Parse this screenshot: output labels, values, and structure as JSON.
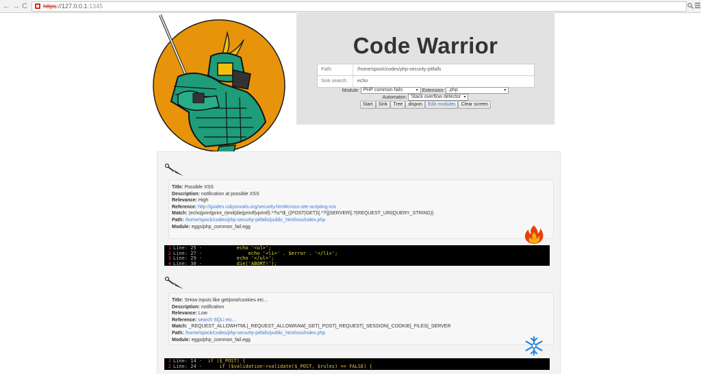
{
  "browser": {
    "back": "←",
    "forward": "→",
    "reload": "C",
    "url_scheme": "https",
    "url_host": "://127.0.0.1",
    "url_port": ":1345",
    "zoom_icon": "magnifier-icon",
    "menu_icon": "menu-icon"
  },
  "app": {
    "title": "Code Warrior"
  },
  "form": {
    "path_label": "Path:",
    "path_value": "/home/spock/codes/php-security-pitfalls",
    "sink_label": "Sink search:",
    "sink_value": "echo",
    "module_label": "Module:",
    "module_value": "PHP common fails",
    "extension_label": "Extension:",
    "extension_value": ".php",
    "automaton_label": "Automaton:",
    "automaton_value": "Stack overflow detector"
  },
  "buttons": {
    "start": "Start",
    "sink": "Sink",
    "tree": "Tree",
    "dispon": "dispon",
    "edit_modules": "Edit modules",
    "clear_screen": "Clear screen"
  },
  "results": [
    {
      "title_label": "Title:",
      "title": "Possible XSS",
      "description_label": "Description:",
      "description": "notification at possible XSS",
      "relevance_label": "Relevance:",
      "relevance": "High",
      "reference_label": "Reference:",
      "reference": "http://guides.rubyonrails.org/security.html#cross-site-scripting-xss",
      "match_label": "Match:",
      "match": "(echo|print|print_r|exit|die|printf|vprintf).*?\\s*\\$_((POST|GET)\\[.*?\\]|SERVER\\[.?(REQUEST_URI|QUERY_STRING))",
      "path_label": "Path:",
      "path": "/home/spock/codes/php-security-pitfalls/public_html/xss/index.php",
      "module_label": "Module:",
      "module": "eggs/php_common_fail.egg",
      "badge": "fire-icon",
      "code": [
        {
          "n": "1",
          "line": "Line: 25 -",
          "code": "            echo '<ul>';"
        },
        {
          "n": "2",
          "line": "Line: 27 -",
          "code": "                echo '<li>' . $error . '</li>';"
        },
        {
          "n": "3",
          "line": "Line: 29 -",
          "code": "            echo '</ul>';"
        },
        {
          "n": "4",
          "line": "Line: 30 -",
          "code": "            die('ABORT!');"
        }
      ]
    },
    {
      "title_label": "Title:",
      "title": "SHow inputs like get/post/cookies etc...",
      "description_label": "Description:",
      "description": "notification",
      "relevance_label": "Relevance:",
      "relevance": "Low",
      "reference_label": "Reference:",
      "reference": "search SQLi etc...",
      "match_label": "Match:",
      "match": "_REQUEST_ALLOWHTML|_REQUEST_ALLOWRAW|_GET|_POST|_REQUEST|_SESSION|_COOKIE|_FILES|_SERVER",
      "path_label": "Path:",
      "path": "/home/spock/codes/php-security-pitfalls/public_html/xss/index.php",
      "module_label": "Module:",
      "module": "eggs/php_common_fail.egg",
      "badge": "snowflake-icon",
      "code": [
        {
          "n": "1",
          "line": "Line: 14 -",
          "code": "  if ($_POST) {"
        },
        {
          "n": "2",
          "line": "Line: 24 -",
          "code": "      if ($validation->validate($_POST, $rules) == FALSE) {"
        }
      ]
    }
  ],
  "colors": {
    "panel_bg": "#e2e2e2",
    "title_color": "#333333",
    "link_color": "#3a7ad4",
    "code_bg": "#000000",
    "logo_orange": "#e8940a",
    "armor_teal": "#1f9c7a"
  }
}
